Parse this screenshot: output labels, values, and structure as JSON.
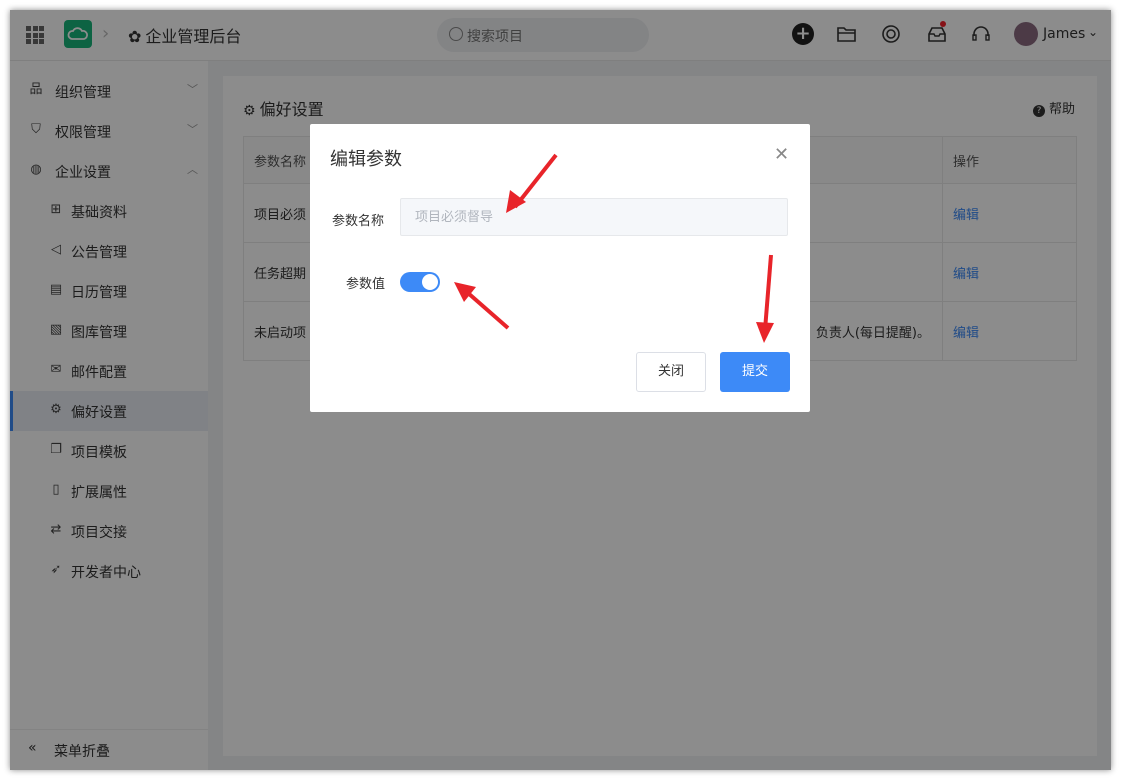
{
  "topbar": {
    "app_title": "企业管理后台",
    "search_placeholder": "搜索项目",
    "username": "James"
  },
  "sidebar": {
    "items": [
      {
        "label": "组织管理"
      },
      {
        "label": "权限管理"
      },
      {
        "label": "企业设置"
      },
      {
        "label": "基础资料"
      },
      {
        "label": "公告管理"
      },
      {
        "label": "日历管理"
      },
      {
        "label": "图库管理"
      },
      {
        "label": "邮件配置"
      },
      {
        "label": "偏好设置"
      },
      {
        "label": "项目模板"
      },
      {
        "label": "扩展属性"
      },
      {
        "label": "项目交接"
      },
      {
        "label": "开发者中心"
      }
    ],
    "collapse_label": "菜单折叠"
  },
  "main": {
    "title": "偏好设置",
    "help_label": "帮助",
    "table": {
      "headers": [
        "参数名称",
        "操作"
      ],
      "rows": [
        {
          "name": "项目必须",
          "desc": "",
          "action": "编辑"
        },
        {
          "name": "任务超期",
          "desc": "",
          "action": "编辑"
        },
        {
          "name": "未启动项",
          "desc": "负责人(每日提醒)。",
          "action": "编辑"
        }
      ]
    }
  },
  "modal": {
    "title": "编辑参数",
    "name_label": "参数名称",
    "name_value": "项目必须督导",
    "value_label": "参数值",
    "toggle_on": true,
    "close_label": "关闭",
    "submit_label": "提交"
  },
  "colors": {
    "accent": "#3d8af7",
    "annotation": "#e8242a"
  }
}
